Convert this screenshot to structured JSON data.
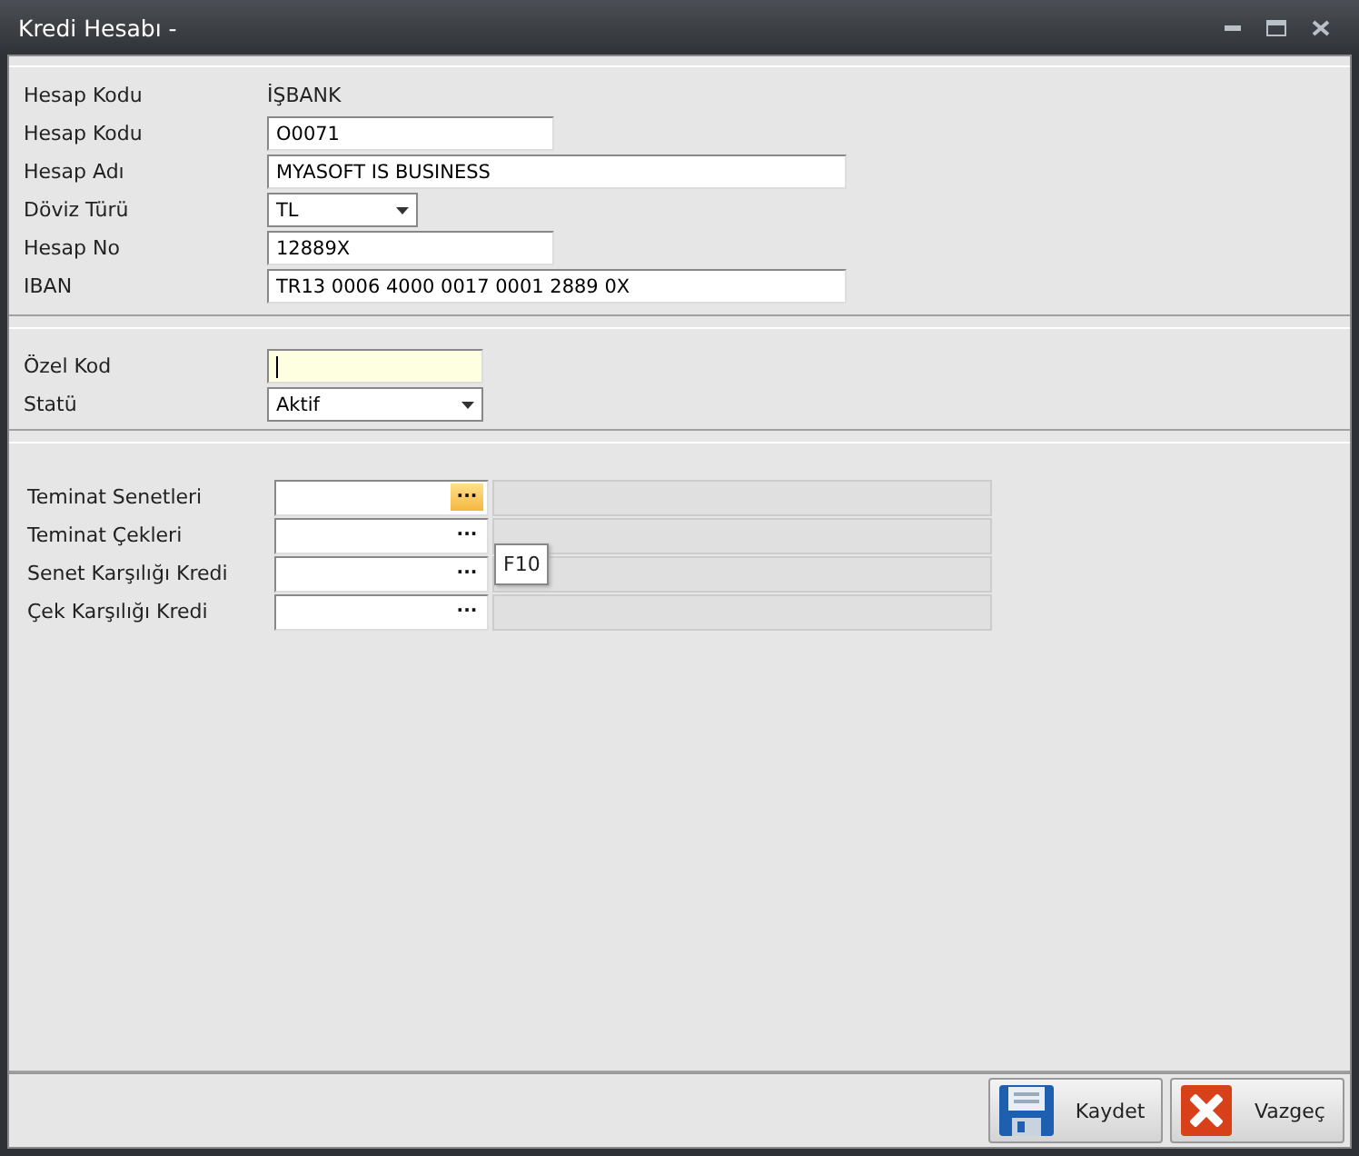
{
  "window": {
    "title": "Kredi Hesabı -"
  },
  "account_section": [
    {
      "label": "Hesap Kodu",
      "kind": "static",
      "value": "İŞBANK"
    },
    {
      "label": "Hesap Kodu",
      "kind": "input",
      "value": "O0071"
    },
    {
      "label": "Hesap Adı",
      "kind": "input",
      "value": "MYASOFT IS BUSINESS"
    },
    {
      "label": "Döviz Türü",
      "kind": "select",
      "value": "TL"
    },
    {
      "label": "Hesap No",
      "kind": "input",
      "value": "12889X"
    },
    {
      "label": "IBAN",
      "kind": "input",
      "value": "TR13 0006 4000 0017 0001 2889 0X"
    }
  ],
  "code_section": [
    {
      "label": "Özel Kod",
      "kind": "input",
      "focused": true
    },
    {
      "label": "Statü",
      "kind": "select",
      "value": "Aktif",
      "focused": false
    }
  ],
  "lookup_section": [
    {
      "label": "Teminat Senetleri",
      "highlighted": true
    },
    {
      "label": "Teminat Çekleri",
      "highlighted": false
    },
    {
      "label": "Senet Karşılığı Kredi",
      "highlighted": false
    },
    {
      "label": "Çek Karşılığı Kredi",
      "highlighted": false
    }
  ],
  "lookup_button": {
    "text": "···"
  },
  "tooltip": {
    "text": "F10"
  },
  "buttons": [
    {
      "kind": "save",
      "label": "Kaydet"
    },
    {
      "kind": "cancel",
      "label": "Vazgeç"
    }
  ]
}
